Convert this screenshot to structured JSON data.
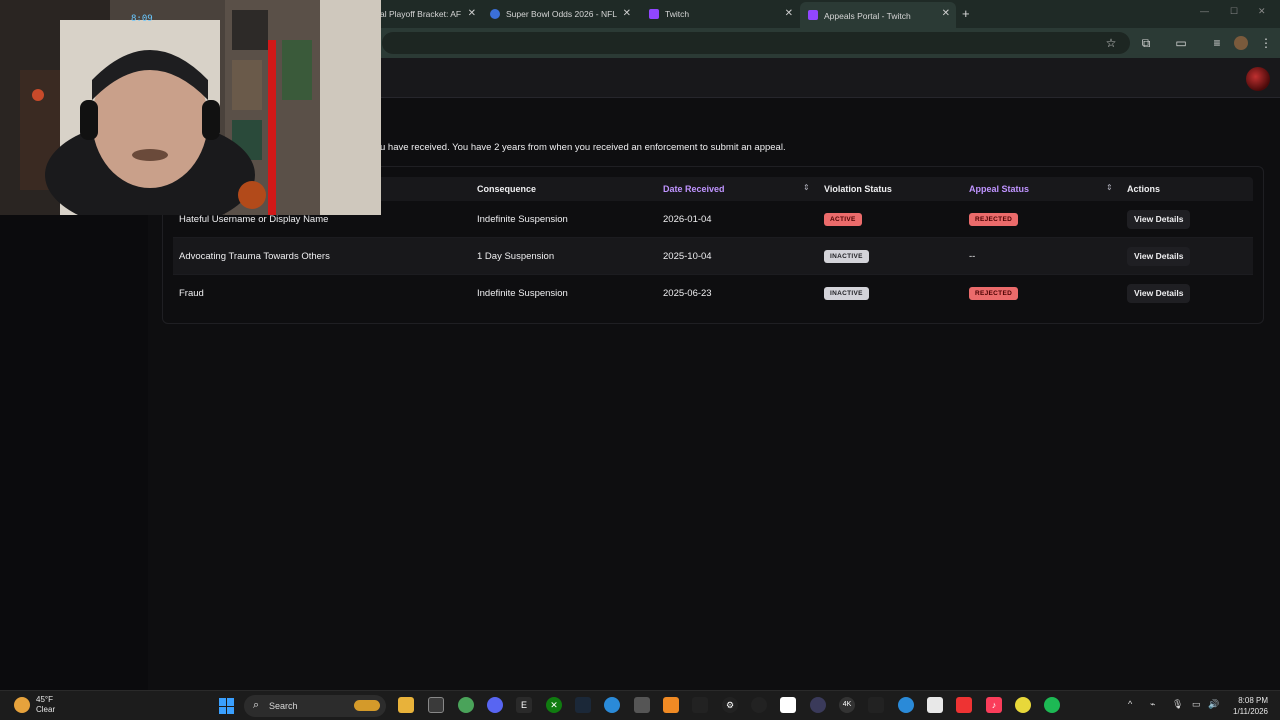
{
  "browser": {
    "tabs": [
      {
        "label": "al Playoff Bracket: AF",
        "active": false,
        "icon": "nfl-icon"
      },
      {
        "label": "Super Bowl Odds 2026 - NFL C",
        "active": false,
        "icon": "shield-icon"
      },
      {
        "label": "Twitch",
        "active": false,
        "icon": "twitch-icon"
      },
      {
        "label": "Appeals Portal - Twitch",
        "active": true,
        "icon": "twitch-icon"
      }
    ],
    "new_tab": "+"
  },
  "intro_text": "u have received. You have 2 years from when you received an enforcement to submit an appeal.",
  "table": {
    "headers": [
      "Consequence",
      "Date Received",
      "Violation Status",
      "Appeal Status",
      "Actions"
    ],
    "rows": [
      {
        "violation": "Hateful Username or Display Name",
        "consequence": "Indefinite Suspension",
        "date": "2026-01-04",
        "violation_status": "ACTIVE",
        "appeal_status": "REJECTED",
        "action": "View Details"
      },
      {
        "violation": "Advocating Trauma Towards Others",
        "consequence": "1 Day Suspension",
        "date": "2025-10-04",
        "violation_status": "INACTIVE",
        "appeal_status": "--",
        "action": "View Details"
      },
      {
        "violation": "Fraud",
        "consequence": "Indefinite Suspension",
        "date": "2025-06-23",
        "violation_status": "INACTIVE",
        "appeal_status": "REJECTED",
        "action": "View Details"
      }
    ]
  },
  "webcam": {
    "clock_overlay": "8:09"
  },
  "taskbar": {
    "weather_temp": "45°F",
    "weather_cond": "Clear",
    "search_label": "Search",
    "time": "8:08 PM",
    "date": "1/11/2026"
  },
  "colors": {
    "accent": "#bf94ff",
    "badge_red": "#eb6b6b",
    "badge_gray": "#d3d3d9",
    "background": "#0e0e10"
  }
}
